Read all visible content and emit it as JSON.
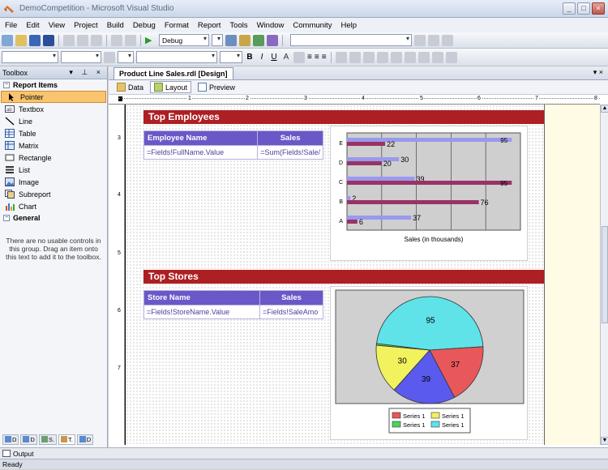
{
  "window": {
    "title": "DemoCompetition - Microsoft Visual Studio"
  },
  "menu": [
    "File",
    "Edit",
    "View",
    "Project",
    "Build",
    "Debug",
    "Format",
    "Report",
    "Tools",
    "Window",
    "Community",
    "Help"
  ],
  "toolbar": {
    "config": "Debug"
  },
  "toolbox": {
    "title": "Toolbox",
    "group_report": "Report Items",
    "items": [
      "Pointer",
      "Textbox",
      "Line",
      "Table",
      "Matrix",
      "Rectangle",
      "List",
      "Image",
      "Subreport",
      "Chart"
    ],
    "group_general": "General",
    "general_note": "There are no usable controls in this group. Drag an item onto this text to add it to the toolbox."
  },
  "document": {
    "tab": "Product Line Sales.rdl [Design]",
    "subtabs": [
      "Data",
      "Layout",
      "Preview"
    ]
  },
  "ruler": [
    "1",
    "2",
    "3",
    "4",
    "5",
    "6",
    "7",
    "8"
  ],
  "vruler": [
    "3",
    "4",
    "5",
    "6",
    "7"
  ],
  "report": {
    "top_employees": {
      "title": "Top Employees",
      "headers": [
        "Employee Name",
        "Sales"
      ],
      "row": [
        "=Fields!FullName.Value",
        "=Sum(Fields!Sale/"
      ]
    },
    "top_stores": {
      "title": "Top Stores",
      "headers": [
        "Store Name",
        "Sales"
      ],
      "row": [
        "=Fields!StoreName.Value",
        "=Fields!SaleAmo"
      ]
    }
  },
  "chart_data": [
    {
      "type": "bar",
      "categories": [
        "E",
        "D",
        "C",
        "B",
        "A"
      ],
      "series": [
        {
          "values": [
            95,
            30,
            39,
            2,
            37
          ]
        },
        {
          "values": [
            22,
            20,
            95,
            76,
            6
          ]
        }
      ],
      "xlabel": "Sales (in thousands)",
      "colors": [
        "#9999ee",
        "#993366"
      ]
    },
    {
      "type": "pie",
      "values": [
        95,
        37,
        39,
        30,
        1
      ],
      "colors": [
        "#5fe3e8",
        "#e8585a",
        "#5a5aee",
        "#f2f25e",
        "#4ed25e"
      ],
      "legend": [
        "Series 1",
        "Series 1",
        "Series 1",
        "Series 1"
      ],
      "legend_colors": [
        "#e8585a",
        "#f2f25e",
        "#4ed25e",
        "#5fe3e8"
      ]
    }
  ],
  "output": {
    "label": "Output"
  },
  "status": {
    "text": "Ready"
  }
}
